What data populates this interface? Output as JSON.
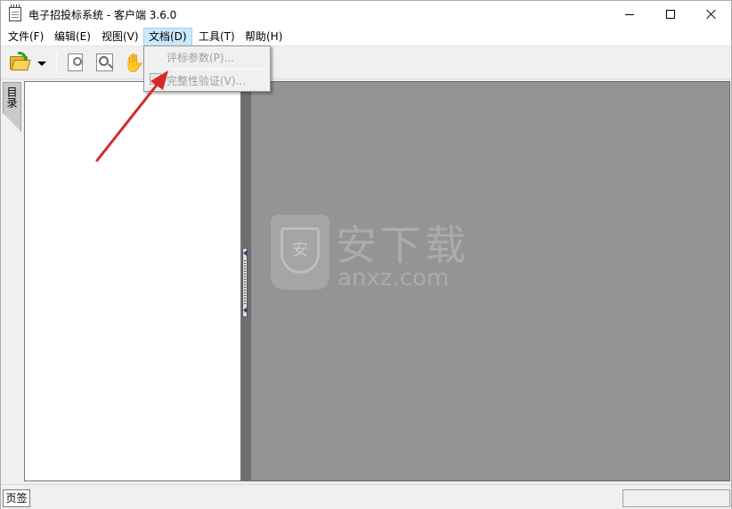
{
  "window": {
    "title": "电子招投标系统 - 客户端 3.6.0"
  },
  "menu": {
    "items": [
      {
        "label": "文件(F)"
      },
      {
        "label": "编辑(E)"
      },
      {
        "label": "视图(V)"
      },
      {
        "label": "文档(D)"
      },
      {
        "label": "工具(T)"
      },
      {
        "label": "帮助(H)"
      }
    ],
    "active_index": 3
  },
  "document_menu": {
    "items": [
      {
        "label": "评标参数(P)...",
        "enabled": false
      },
      {
        "label": "完整性验证(V)...",
        "enabled": false
      }
    ]
  },
  "toolbar": {
    "icons": [
      "folder-open-icon",
      "dropdown-caret-icon",
      "find-page-icon",
      "zoom-page-icon",
      "hand-icon"
    ]
  },
  "sidebar": {
    "tab_label": "目录"
  },
  "watermark": {
    "badge": "安",
    "title": "安下载",
    "subtitle": "anxz.com"
  },
  "statusbar": {
    "tab_label": "页签",
    "field_value": ""
  },
  "colors": {
    "doc_area": "#959395",
    "menu_active": "#cce8ff",
    "arrow": "#d42a2a"
  }
}
